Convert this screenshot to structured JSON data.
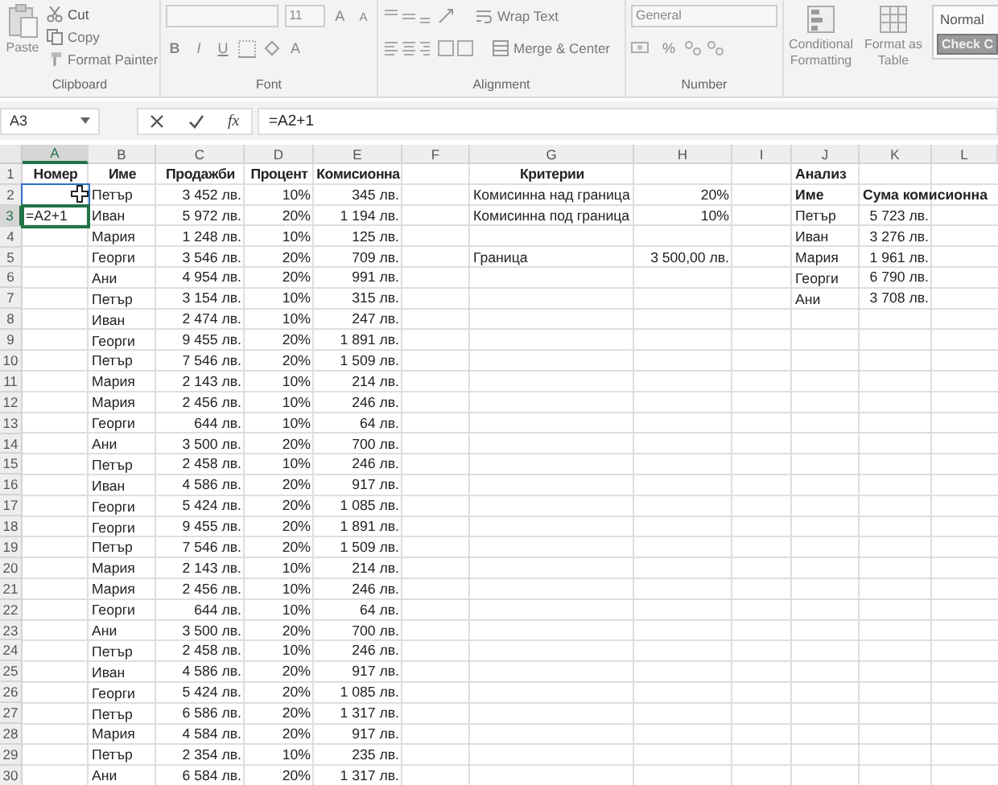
{
  "ribbon": {
    "clipboard": {
      "label": "Clipboard",
      "paste": "Paste",
      "cut": "Cut",
      "copy": "Copy",
      "format_painter": "Format Painter"
    },
    "font": {
      "label": "Font",
      "size": "11",
      "grow": "A",
      "shrink": "A",
      "bold": "B",
      "italic": "I",
      "underline": "U",
      "font_color": "A"
    },
    "alignment": {
      "label": "Alignment",
      "wrap_text": "Wrap Text",
      "merge_center": "Merge & Center"
    },
    "number": {
      "label": "Number",
      "format": "General",
      "percent": "%"
    },
    "styles": {
      "conditional_formatting": "Conditional Formatting",
      "format_as_table": "Format as Table",
      "normal": "Normal",
      "check_cell": "Check C"
    }
  },
  "formula_bar": {
    "name_box": "A3",
    "fx": "fx",
    "formula": "=A2+1"
  },
  "sheet": {
    "columns": [
      {
        "label": "A",
        "selected": true
      },
      {
        "label": "B",
        "selected": false
      },
      {
        "label": "C",
        "selected": false
      },
      {
        "label": "D",
        "selected": false
      },
      {
        "label": "E",
        "selected": false
      },
      {
        "label": "F",
        "selected": false
      },
      {
        "label": "G",
        "selected": false
      },
      {
        "label": "H",
        "selected": false
      },
      {
        "label": "I",
        "selected": false
      },
      {
        "label": "J",
        "selected": false
      },
      {
        "label": "K",
        "selected": false
      },
      {
        "label": "L",
        "selected": false
      }
    ],
    "rows": [
      {
        "number": "1",
        "selected": false,
        "cells": [
          {
            "text": "Номер",
            "kind": "heading"
          },
          {
            "text": "Име",
            "kind": "heading"
          },
          {
            "text": "Продажби",
            "kind": "heading"
          },
          {
            "text": "Процент",
            "kind": "heading"
          },
          {
            "text": "Комисионна",
            "kind": "heading"
          },
          null,
          {
            "text": "Критерии",
            "kind": "heading"
          },
          null,
          null,
          {
            "text": "Анализ",
            "kind": "label"
          },
          null,
          null
        ]
      },
      {
        "number": "2",
        "selected": false,
        "cells": [
          {
            "referenced": true
          },
          "Петър",
          "3 452 лв.",
          "10%",
          "345 лв.",
          null,
          "Комисинна над граница",
          "20%",
          null,
          {
            "text": "Име",
            "kind": "label"
          },
          {
            "text": "Сума комисионна",
            "kind": "label"
          },
          null
        ]
      },
      {
        "number": "3",
        "selected": true,
        "cells": [
          {
            "text": "=A2+1",
            "kind": "formula",
            "selected": true
          },
          "Иван",
          "5 972 лв.",
          "20%",
          "1 194 лв.",
          null,
          "Комисинна под граница",
          "10%",
          null,
          "Петър",
          "5 723 лв.",
          null
        ]
      },
      {
        "number": "4",
        "selected": false,
        "cells": [
          null,
          "Мария",
          "1 248 лв.",
          "10%",
          "125 лв.",
          null,
          null,
          null,
          null,
          "Иван",
          "3 276 лв.",
          null
        ]
      },
      {
        "number": "5",
        "selected": false,
        "cells": [
          null,
          "Георги",
          "3 546 лв.",
          "20%",
          "709 лв.",
          null,
          "Граница",
          "3 500,00 лв.",
          null,
          "Мария",
          "1 961 лв.",
          null
        ]
      },
      {
        "number": "6",
        "selected": false,
        "cells": [
          null,
          "Ани",
          "4 954 лв.",
          "20%",
          "991 лв.",
          null,
          null,
          null,
          null,
          "Георги",
          "6 790 лв.",
          null
        ]
      },
      {
        "number": "7",
        "selected": false,
        "cells": [
          null,
          "Петър",
          "3 154 лв.",
          "10%",
          "315 лв.",
          null,
          null,
          null,
          null,
          "Ани",
          "3 708 лв.",
          null
        ]
      },
      {
        "number": "8",
        "selected": false,
        "cells": [
          null,
          "Иван",
          "2 474 лв.",
          "10%",
          "247 лв.",
          null,
          null,
          null,
          null,
          null,
          null,
          null
        ]
      },
      {
        "number": "9",
        "selected": false,
        "cells": [
          null,
          "Георги",
          "9 455 лв.",
          "20%",
          "1 891 лв.",
          null,
          null,
          null,
          null,
          null,
          null,
          null
        ]
      },
      {
        "number": "10",
        "selected": false,
        "cells": [
          null,
          "Петър",
          "7 546 лв.",
          "20%",
          "1 509 лв.",
          null,
          null,
          null,
          null,
          null,
          null,
          null
        ]
      },
      {
        "number": "11",
        "selected": false,
        "cells": [
          null,
          "Мария",
          "2 143 лв.",
          "10%",
          "214 лв.",
          null,
          null,
          null,
          null,
          null,
          null,
          null
        ]
      },
      {
        "number": "12",
        "selected": false,
        "cells": [
          null,
          "Мария",
          "2 456 лв.",
          "10%",
          "246 лв.",
          null,
          null,
          null,
          null,
          null,
          null,
          null
        ]
      },
      {
        "number": "13",
        "selected": false,
        "cells": [
          null,
          "Георги",
          "644 лв.",
          "10%",
          "64 лв.",
          null,
          null,
          null,
          null,
          null,
          null,
          null
        ]
      },
      {
        "number": "14",
        "selected": false,
        "cells": [
          null,
          "Ани",
          "3 500 лв.",
          "20%",
          "700 лв.",
          null,
          null,
          null,
          null,
          null,
          null,
          null
        ]
      },
      {
        "number": "15",
        "selected": false,
        "cells": [
          null,
          "Петър",
          "2 458 лв.",
          "10%",
          "246 лв.",
          null,
          null,
          null,
          null,
          null,
          null,
          null
        ]
      },
      {
        "number": "16",
        "selected": false,
        "cells": [
          null,
          "Иван",
          "4 586 лв.",
          "20%",
          "917 лв.",
          null,
          null,
          null,
          null,
          null,
          null,
          null
        ]
      },
      {
        "number": "17",
        "selected": false,
        "cells": [
          null,
          "Георги",
          "5 424 лв.",
          "20%",
          "1 085 лв.",
          null,
          null,
          null,
          null,
          null,
          null,
          null
        ]
      },
      {
        "number": "18",
        "selected": false,
        "cells": [
          null,
          "Георги",
          "9 455 лв.",
          "20%",
          "1 891 лв.",
          null,
          null,
          null,
          null,
          null,
          null,
          null
        ]
      },
      {
        "number": "19",
        "selected": false,
        "cells": [
          null,
          "Петър",
          "7 546 лв.",
          "20%",
          "1 509 лв.",
          null,
          null,
          null,
          null,
          null,
          null,
          null
        ]
      },
      {
        "number": "20",
        "selected": false,
        "cells": [
          null,
          "Мария",
          "2 143 лв.",
          "10%",
          "214 лв.",
          null,
          null,
          null,
          null,
          null,
          null,
          null
        ]
      },
      {
        "number": "21",
        "selected": false,
        "cells": [
          null,
          "Мария",
          "2 456 лв.",
          "10%",
          "246 лв.",
          null,
          null,
          null,
          null,
          null,
          null,
          null
        ]
      },
      {
        "number": "22",
        "selected": false,
        "cells": [
          null,
          "Георги",
          "644 лв.",
          "10%",
          "64 лв.",
          null,
          null,
          null,
          null,
          null,
          null,
          null
        ]
      },
      {
        "number": "23",
        "selected": false,
        "cells": [
          null,
          "Ани",
          "3 500 лв.",
          "20%",
          "700 лв.",
          null,
          null,
          null,
          null,
          null,
          null,
          null
        ]
      },
      {
        "number": "24",
        "selected": false,
        "cells": [
          null,
          "Петър",
          "2 458 лв.",
          "10%",
          "246 лв.",
          null,
          null,
          null,
          null,
          null,
          null,
          null
        ]
      },
      {
        "number": "25",
        "selected": false,
        "cells": [
          null,
          "Иван",
          "4 586 лв.",
          "20%",
          "917 лв.",
          null,
          null,
          null,
          null,
          null,
          null,
          null
        ]
      },
      {
        "number": "26",
        "selected": false,
        "cells": [
          null,
          "Георги",
          "5 424 лв.",
          "20%",
          "1 085 лв.",
          null,
          null,
          null,
          null,
          null,
          null,
          null
        ]
      },
      {
        "number": "27",
        "selected": false,
        "cells": [
          null,
          "Петър",
          "6 586 лв.",
          "20%",
          "1 317 лв.",
          null,
          null,
          null,
          null,
          null,
          null,
          null
        ]
      },
      {
        "number": "28",
        "selected": false,
        "cells": [
          null,
          "Мария",
          "4 584 лв.",
          "20%",
          "917 лв.",
          null,
          null,
          null,
          null,
          null,
          null,
          null
        ]
      },
      {
        "number": "29",
        "selected": false,
        "cells": [
          null,
          "Петър",
          "2 354 лв.",
          "10%",
          "235 лв.",
          null,
          null,
          null,
          null,
          null,
          null,
          null
        ]
      },
      {
        "number": "30",
        "selected": false,
        "cells": [
          null,
          "Ани",
          "6 584 лв.",
          "20%",
          "1 317 лв.",
          null,
          null,
          null,
          null,
          null,
          null,
          null
        ]
      }
    ]
  }
}
